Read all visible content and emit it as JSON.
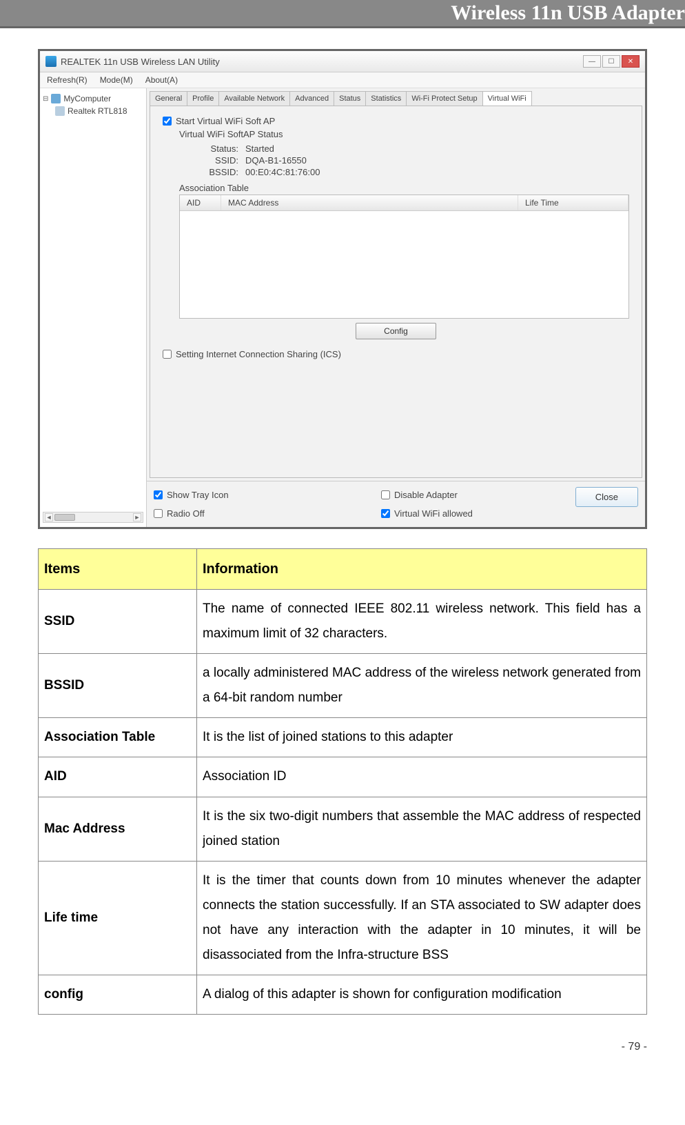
{
  "header": {
    "title": "Wireless 11n USB Adapter"
  },
  "screenshot": {
    "window_title": "REALTEK 11n USB Wireless LAN Utility",
    "menus": [
      "Refresh(R)",
      "Mode(M)",
      "About(A)"
    ],
    "tree": {
      "root": "MyComputer",
      "child": "Realtek RTL818"
    },
    "tabs": [
      "General",
      "Profile",
      "Available Network",
      "Advanced",
      "Status",
      "Statistics",
      "Wi-Fi Protect Setup",
      "Virtual WiFi"
    ],
    "active_tab_index": 7,
    "start_ap_label": "Start Virtual WiFi Soft AP",
    "softap_status_title": "Virtual WiFi SoftAP Status",
    "status_label": "Status:",
    "status_value": "Started",
    "ssid_label": "SSID:",
    "ssid_value": "DQA-B1-16550",
    "bssid_label": "BSSID:",
    "bssid_value": "00:E0:4C:81:76:00",
    "assoc_table_label": "Association Table",
    "assoc_headers": {
      "aid": "AID",
      "mac": "MAC Address",
      "life": "Life Time"
    },
    "config_button": "Config",
    "ics_label": "Setting Internet Connection Sharing (ICS)",
    "opt_show_tray": "Show Tray Icon",
    "opt_radio_off": "Radio Off",
    "opt_disable": "Disable Adapter",
    "opt_vwifi": "Virtual WiFi allowed",
    "close_button": "Close"
  },
  "table": {
    "head_items": "Items",
    "head_info": "Information",
    "rows": [
      {
        "item": "SSID",
        "info": "The name of connected IEEE 802.11 wireless network. This field has a maximum limit of 32 characters."
      },
      {
        "item": "BSSID",
        "info": "a locally administered MAC address of the wireless network generated from a 64-bit random number"
      },
      {
        "item": "Association Table",
        "info": "It is the list of joined stations to this adapter"
      },
      {
        "item": "AID",
        "info": "Association ID"
      },
      {
        "item": "Mac Address",
        "info": "It is the six two-digit numbers that assemble the MAC address of respected joined station"
      },
      {
        "item": "Life time",
        "info": "It is the timer that counts down from 10 minutes whenever the adapter connects the station successfully. If an STA associated to SW adapter does not have any interaction with the adapter in 10 minutes, it will be disassociated from the Infra-structure BSS"
      },
      {
        "item": "config",
        "info": "A dialog of this adapter is shown for configuration modification"
      }
    ]
  },
  "page_number": "- 79 -"
}
